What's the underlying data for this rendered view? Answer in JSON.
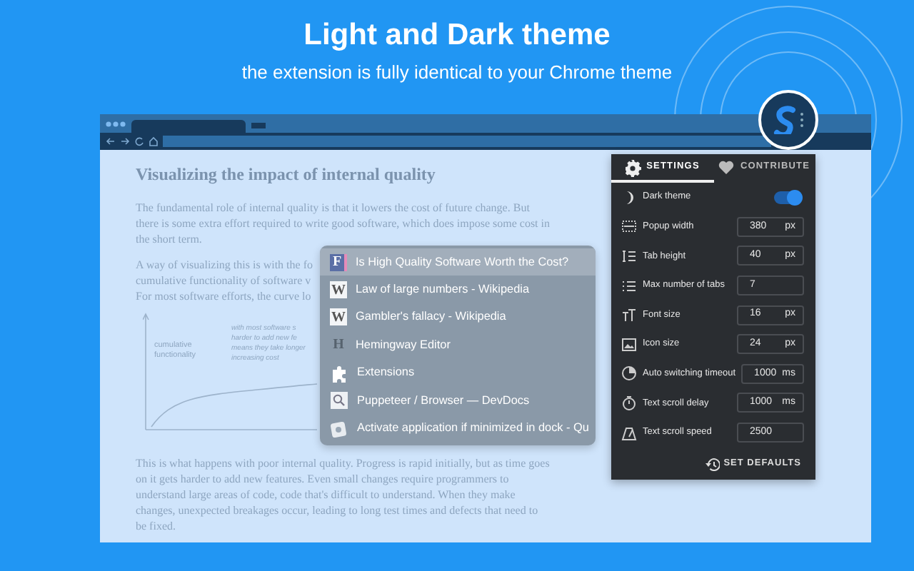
{
  "header": {
    "title": "Light and Dark theme",
    "subtitle": "the extension is fully identical to your Chrome theme"
  },
  "article": {
    "heading": "Visualizing the impact of internal quality",
    "paragraph_1": "The fundamental role of internal quality is that it lowers the cost of future change. But there is some extra effort required to write good software, which does impose some cost in the short term.",
    "paragraph_2_lines": [
      "A way of visualizing this is with the fo",
      "cumulative functionality of software v",
      "For most software efforts, the curve lo"
    ],
    "chart_labels": {
      "y_axis": "cumulative functionality",
      "note_lines": [
        "with most software s",
        "harder to add new fe",
        "means they take longer",
        "increasing cost"
      ]
    },
    "paragraph_3": "This is what happens with poor internal quality. Progress is rapid initially, but as time goes on it gets harder to add new features. Even small changes require programmers to understand large areas of code, code that's difficult to understand. When they make changes, unexpected breakages occur, leading to long test times and defects that need to be fixed."
  },
  "tab_switcher": [
    {
      "title": "Is High Quality Software Worth the Cost?",
      "kind": "letter",
      "icon_text": "F",
      "selected": true
    },
    {
      "title": "Law of large numbers - Wikipedia",
      "kind": "letter",
      "icon_text": "W",
      "selected": false
    },
    {
      "title": "Gambler's fallacy - Wikipedia",
      "kind": "letter",
      "icon_text": "W",
      "selected": false
    },
    {
      "title": "Hemingway Editor",
      "kind": "letter",
      "icon_text": "H",
      "selected": false
    },
    {
      "title": "Extensions",
      "kind": "puzzle",
      "selected": false
    },
    {
      "title": "Puppeteer / Browser — DevDocs",
      "kind": "search",
      "selected": false
    },
    {
      "title": "Activate application if minimized in dock - Qu",
      "kind": "app",
      "selected": false
    }
  ],
  "settings": {
    "tabs": [
      {
        "label": "SETTINGS",
        "selected": true
      },
      {
        "label": "CONTRIBUTE",
        "selected": false
      }
    ],
    "rows": [
      {
        "kind": "toggle",
        "label": "Dark theme",
        "checked": true
      },
      {
        "kind": "input",
        "label": "Popup width",
        "value": "380",
        "unit": "px"
      },
      {
        "kind": "input",
        "label": "Tab height",
        "value": "40",
        "unit": "px"
      },
      {
        "kind": "input",
        "label": "Max number of tabs",
        "value": "7"
      },
      {
        "kind": "input",
        "label": "Font size",
        "value": "16",
        "unit": "px"
      },
      {
        "kind": "input",
        "label": "Icon size",
        "value": "24",
        "unit": "px"
      },
      {
        "kind": "input",
        "label": "Auto switching timeout",
        "value": "1000",
        "unit": "ms"
      },
      {
        "kind": "input",
        "label": "Text scroll delay",
        "value": "1000",
        "unit": "ms"
      },
      {
        "kind": "input",
        "label": "Text scroll speed",
        "value": "2500"
      }
    ],
    "reset_button": "SET DEFAULTS"
  }
}
